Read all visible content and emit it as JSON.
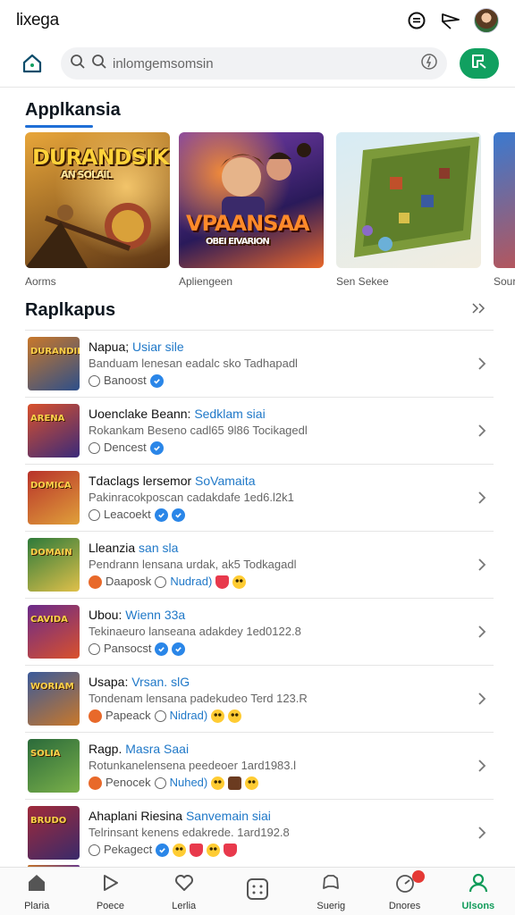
{
  "app": {
    "brand": "lixega",
    "top_icons": [
      "chat-bubble-icon",
      "send-icon",
      "profile-avatar"
    ]
  },
  "search": {
    "value": "inlomgemsomsin",
    "icons": [
      "home-icon",
      "search-icon",
      "mic-icon",
      "scan-icon"
    ]
  },
  "featured": {
    "title": "Applkansia",
    "cards": [
      {
        "caption": "Aorms",
        "art_title": "DURANDSIK",
        "art_sub": "AN SOLAIL",
        "colors": [
          "#e8a63a",
          "#5b3414"
        ]
      },
      {
        "caption": "Apliengeen",
        "art_title": "VPAANSAA",
        "art_sub": "OBEI EIVARION",
        "colors": [
          "#7b3fb0",
          "#e8672a"
        ]
      },
      {
        "caption": "Sen Sekee",
        "art_title": "",
        "art_sub": "",
        "colors": [
          "#6bb0d8",
          "#7c9a3a"
        ]
      },
      {
        "caption": "Sour",
        "art_title": "",
        "art_sub": "",
        "colors": [
          "#3a7ad0",
          "#d94b3a"
        ]
      }
    ]
  },
  "list_section": {
    "title": "Raplkapus",
    "more_icon": "double-chevron-icon",
    "items": [
      {
        "name": "Napua; ",
        "accent": "Usiar sile",
        "desc": "Banduam lenesan eadalc sko Tadhapadl",
        "meta": "Banoost",
        "badges": [
          "check"
        ],
        "thumb_text": "DURANDIK",
        "colors": [
          "#c9782a",
          "#2d4f8a"
        ]
      },
      {
        "name": "Uoenclake Beann: ",
        "accent": "Sedklam siai",
        "desc": "Rokankam Beseno cadl65 9l86 Tocikagedl",
        "meta": "Dencest",
        "badges": [
          "check"
        ],
        "thumb_text": "ARENA",
        "colors": [
          "#d9512c",
          "#3a2a7a"
        ]
      },
      {
        "name": "Tdaclags lersemor ",
        "accent": "SoVamaita",
        "desc": "Pakinracokposcan cadakdafe 1ed6.l2k1",
        "meta": "Leacoekt",
        "badges": [
          "check",
          "check"
        ],
        "thumb_text": "DOMICA",
        "colors": [
          "#b8322a",
          "#e0a03a"
        ]
      },
      {
        "name": "Lleanzia ",
        "accent": "san sla",
        "desc": "Pendrann lensana urdak, ak5 Todkagadl",
        "meta": "Daaposk",
        "meta_circle": "Nudrad)",
        "badges": [
          "heart",
          "smile"
        ],
        "thumb_text": "DOMAIN",
        "colors": [
          "#2d7a3a",
          "#e0c04a"
        ]
      },
      {
        "name": "Ubou: ",
        "accent": "Wienn 33a",
        "desc": "Tekinaeuro lanseana adakdey 1ed0122.8",
        "meta": "Pansocst",
        "badges": [
          "check",
          "check"
        ],
        "thumb_text": "CAVIDA",
        "colors": [
          "#6a2a8a",
          "#d9512c"
        ]
      },
      {
        "name": "Usapa: ",
        "accent": "Vrsan. slG",
        "desc": "Tondenam lensana padekudeo Terd 123.R",
        "meta": "Papeack",
        "meta_circle": "Nidrad)",
        "badges": [
          "smile",
          "smile"
        ],
        "thumb_text": "WORIAM",
        "colors": [
          "#3a5a9a",
          "#c9782a"
        ]
      },
      {
        "name": "Ragp. ",
        "accent": "Masra Saai",
        "desc": "Rotunkanelensena peedeoer 1ard1983.l",
        "meta": "Penocek",
        "meta_circle": "Nuhed)",
        "badges": [
          "smile",
          "box",
          "smile"
        ],
        "thumb_text": "SOLIA",
        "colors": [
          "#2a6a3a",
          "#7ab04a"
        ]
      },
      {
        "name": "Ahaplani Riesina ",
        "accent": "Sanvemain siai",
        "desc": "Telrinsant kenens edakrede. 1ard192.8",
        "meta": "Pekagect",
        "badges": [
          "check",
          "smile",
          "heart",
          "smile",
          "heart"
        ],
        "thumb_text": "BRUDO",
        "colors": [
          "#a02a3a",
          "#3a2a6a"
        ]
      }
    ]
  },
  "bottom_nav": [
    {
      "label": "Plaria",
      "icon": "home-icon",
      "active": false
    },
    {
      "label": "Poece",
      "icon": "play-icon",
      "active": false
    },
    {
      "label": "Lerlia",
      "icon": "heart-icon",
      "active": false
    },
    {
      "label": "",
      "icon": "grid-icon",
      "active": false
    },
    {
      "label": "Suerig",
      "icon": "controller-icon",
      "active": false
    },
    {
      "label": "Dnores",
      "icon": "speed-icon",
      "active": false,
      "badge": true
    },
    {
      "label": "Ulsons",
      "icon": "user-icon",
      "active": true
    }
  ],
  "colors": {
    "accent_green": "#11a060",
    "link_blue": "#1f78c8",
    "check_blue": "#2a86e8"
  }
}
